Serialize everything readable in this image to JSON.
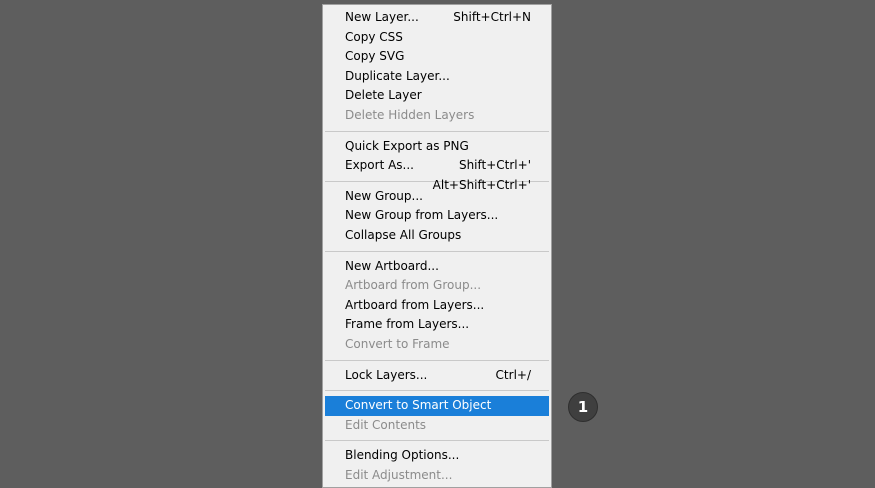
{
  "menu": {
    "groups": [
      [
        {
          "label": "New Layer...",
          "shortcut": "Shift+Ctrl+N",
          "state": "enabled"
        },
        {
          "label": "Copy CSS",
          "shortcut": "",
          "state": "enabled"
        },
        {
          "label": "Copy SVG",
          "shortcut": "",
          "state": "enabled"
        },
        {
          "label": "Duplicate Layer...",
          "shortcut": "",
          "state": "enabled"
        },
        {
          "label": "Delete Layer",
          "shortcut": "",
          "state": "enabled"
        },
        {
          "label": "Delete Hidden Layers",
          "shortcut": "",
          "state": "disabled"
        }
      ],
      [
        {
          "label": "Quick Export as PNG",
          "shortcut": "Shift+Ctrl+'",
          "state": "enabled"
        },
        {
          "label": "Export As...",
          "shortcut": "Alt+Shift+Ctrl+'",
          "state": "enabled"
        }
      ],
      [
        {
          "label": "New Group...",
          "shortcut": "",
          "state": "enabled"
        },
        {
          "label": "New Group from Layers...",
          "shortcut": "",
          "state": "enabled"
        },
        {
          "label": "Collapse All Groups",
          "shortcut": "",
          "state": "enabled"
        }
      ],
      [
        {
          "label": "New Artboard...",
          "shortcut": "",
          "state": "enabled"
        },
        {
          "label": "Artboard from Group...",
          "shortcut": "",
          "state": "disabled"
        },
        {
          "label": "Artboard from Layers...",
          "shortcut": "",
          "state": "enabled"
        },
        {
          "label": "Frame from Layers...",
          "shortcut": "",
          "state": "enabled"
        },
        {
          "label": "Convert to Frame",
          "shortcut": "",
          "state": "disabled"
        }
      ],
      [
        {
          "label": "Lock Layers...",
          "shortcut": "Ctrl+/",
          "state": "enabled"
        }
      ],
      [
        {
          "label": "Convert to Smart Object",
          "shortcut": "",
          "state": "highlighted"
        },
        {
          "label": "Edit Contents",
          "shortcut": "",
          "state": "disabled"
        }
      ],
      [
        {
          "label": "Blending Options...",
          "shortcut": "",
          "state": "enabled"
        },
        {
          "label": "Edit Adjustment...",
          "shortcut": "",
          "state": "disabled"
        }
      ]
    ]
  },
  "callout": {
    "number": "1"
  },
  "colors": {
    "background": "#5e5e5e",
    "menu_bg": "#f0f0f0",
    "highlight": "#1a7fd9",
    "disabled_text": "#8b8b8b",
    "badge_bg": "#3f3f3f"
  }
}
